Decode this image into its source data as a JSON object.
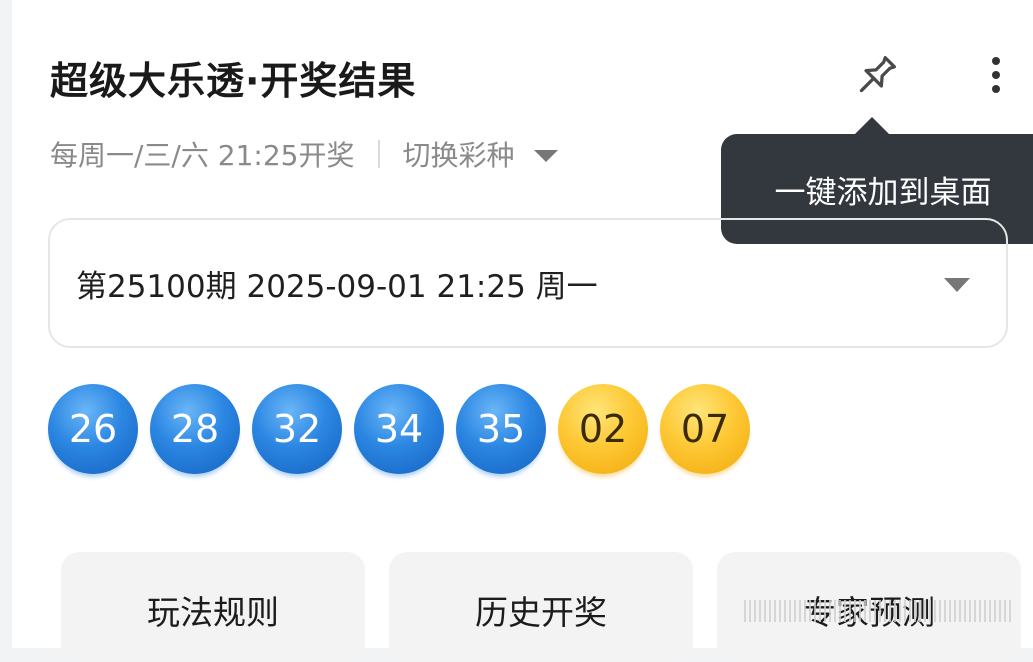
{
  "header": {
    "title": "超级大乐透·开奖结果",
    "schedule": "每周一/三/六 21:25开奖",
    "switch_label": "切换彩种"
  },
  "tooltip": {
    "text": "一键添加到桌面"
  },
  "draw": {
    "period_text": "第25100期 2025-09-01 21:25 周一",
    "front_numbers": [
      "26",
      "28",
      "32",
      "34",
      "35"
    ],
    "back_numbers": [
      "02",
      "07"
    ],
    "colors": {
      "front_ball": "#2b86e2",
      "back_ball": "#fdc834"
    }
  },
  "actions": [
    {
      "label": "玩法规则"
    },
    {
      "label": "历史开奖"
    },
    {
      "label": "专家预测"
    }
  ],
  "icons": {
    "pin": "pin-icon",
    "more": "more-vertical-icon",
    "dropdown": "caret-down-icon"
  }
}
